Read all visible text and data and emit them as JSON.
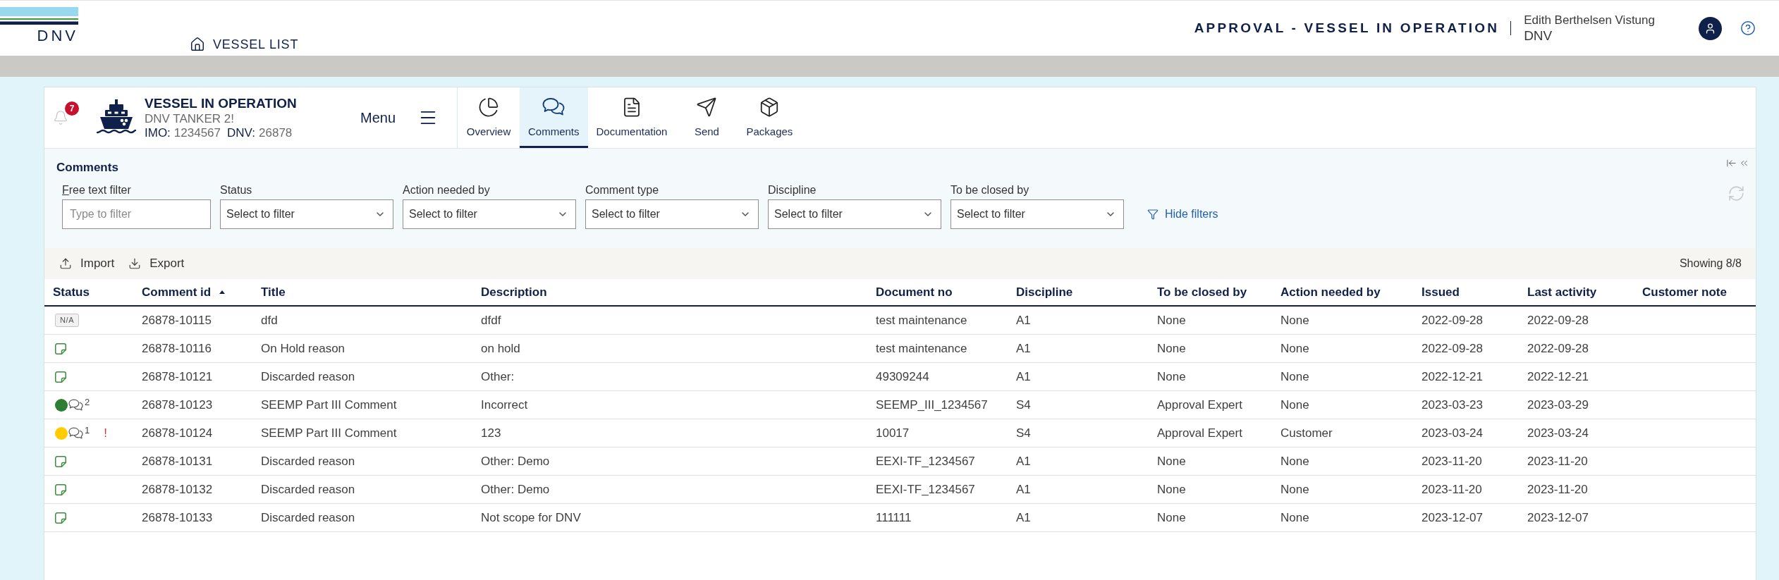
{
  "header": {
    "logo_text": "DNV",
    "nav_link": "VESSEL LIST",
    "app_title": "APPROVAL - VESSEL IN OPERATION",
    "user_name": "Edith Berthelsen Vistung",
    "user_org": "DNV"
  },
  "vessel": {
    "notification_count": "7",
    "heading": "VESSEL IN OPERATION",
    "name": "DNV TANKER 2!",
    "imo_label": "IMO:",
    "imo": "1234567",
    "dnv_label": "DNV:",
    "dnv": "26878",
    "menu_label": "Menu"
  },
  "tabs": [
    {
      "label": "Overview",
      "selected": false
    },
    {
      "label": "Comments",
      "selected": true
    },
    {
      "label": "Documentation",
      "selected": false
    },
    {
      "label": "Send",
      "selected": false
    },
    {
      "label": "Packages",
      "selected": false
    }
  ],
  "comments": {
    "title": "Comments",
    "filters": [
      {
        "label": "Free text filter",
        "kind": "text",
        "placeholder": "Type to filter",
        "accesskey_underlined": true
      },
      {
        "label": "Status",
        "kind": "select",
        "placeholder": "Select to filter",
        "accesskey_underlined": false
      },
      {
        "label": "Action needed by",
        "kind": "select",
        "placeholder": "Select to filter",
        "accesskey_underlined": false
      },
      {
        "label": "Comment type",
        "kind": "select",
        "placeholder": "Select to filter",
        "accesskey_underlined": false
      },
      {
        "label": "Discipline",
        "kind": "select",
        "placeholder": "Select to filter",
        "accesskey_underlined": false
      },
      {
        "label": "To be closed by",
        "kind": "select",
        "placeholder": "Select to filter",
        "accesskey_underlined": false
      }
    ],
    "hide_filters_label": "Hide filters"
  },
  "toolbar": {
    "actions": [
      {
        "label": "Import"
      },
      {
        "label": "Export"
      }
    ],
    "count": "Showing 8/8"
  },
  "table": {
    "columns": [
      {
        "label": "Status",
        "sorted": false
      },
      {
        "label": "Comment id",
        "sorted": true
      },
      {
        "label": "Title",
        "sorted": false
      },
      {
        "label": "Description",
        "sorted": false
      },
      {
        "label": "Document no",
        "sorted": false
      },
      {
        "label": "Discipline",
        "sorted": false
      },
      {
        "label": "To be closed by",
        "sorted": false
      },
      {
        "label": "Action needed by",
        "sorted": false
      },
      {
        "label": "Issued",
        "sorted": false
      },
      {
        "label": "Last activity",
        "sorted": false
      },
      {
        "label": "Customer note",
        "sorted": false
      }
    ],
    "rows": [
      {
        "cells": [
          {
            "kind": "na",
            "text": "N/A"
          },
          "26878-10115",
          "dfd",
          "dfdf",
          "test maintenance",
          "A1",
          "None",
          "None",
          "2022-09-28",
          "2022-09-28"
        ]
      },
      {
        "cells": [
          {
            "kind": "note"
          },
          "26878-10116",
          "On Hold reason",
          "on hold",
          "test maintenance",
          "A1",
          "None",
          "None",
          "2022-09-28",
          "2022-09-28"
        ]
      },
      {
        "cells": [
          {
            "kind": "note"
          },
          "26878-10121",
          "Discarded reason",
          "Other:",
          "49309244",
          "A1",
          "None",
          "None",
          "2022-12-21",
          "2022-12-21"
        ]
      },
      {
        "cells": [
          {
            "kind": "dot",
            "color": "#2e7d32",
            "comments": "2"
          },
          "26878-10123",
          "SEEMP Part III Comment",
          "Incorrect",
          "SEEMP_III_1234567",
          "S4",
          "Approval Expert",
          "None",
          "2023-03-23",
          "2023-03-29"
        ]
      },
      {
        "cells": [
          {
            "kind": "dot",
            "color": "#ffcc00",
            "comments": "1",
            "alert": "!"
          },
          "26878-10124",
          "SEEMP Part III Comment",
          "123",
          "10017",
          "S4",
          "Approval Expert",
          "Customer",
          "2023-03-24",
          "2023-03-24"
        ]
      },
      {
        "cells": [
          {
            "kind": "note"
          },
          "26878-10131",
          "Discarded reason",
          "Other: Demo",
          "EEXI-TF_1234567",
          "A1",
          "None",
          "None",
          "2023-11-20",
          "2023-11-20"
        ]
      },
      {
        "cells": [
          {
            "kind": "note"
          },
          "26878-10132",
          "Discarded reason",
          "Other: Demo",
          "EEXI-TF_1234567",
          "A1",
          "None",
          "None",
          "2023-11-20",
          "2023-11-20"
        ]
      },
      {
        "cells": [
          {
            "kind": "note"
          },
          "26878-10133",
          "Discarded reason",
          "Not scope for DNV",
          "111111",
          "A1",
          "None",
          "None",
          "2023-12-07",
          "2023-12-07"
        ]
      }
    ]
  }
}
